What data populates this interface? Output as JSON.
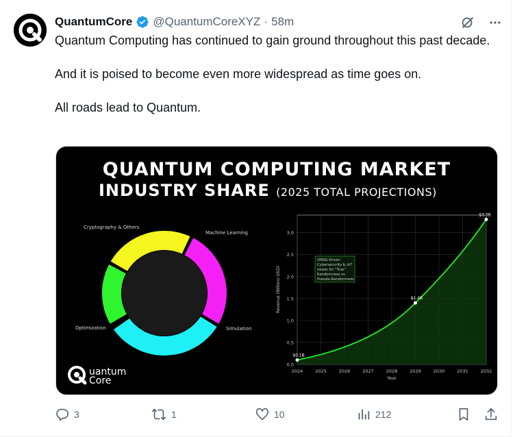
{
  "tweet": {
    "name": "QuantumCore",
    "handle": "@QuantumCoreXYZ",
    "separator": "·",
    "time": "58m",
    "text_lines": [
      "Quantum Computing has continued to gain ground throughout this past decade.",
      "And it is poised to become even more widespread as time goes on.",
      "All roads lead to Quantum."
    ]
  },
  "media": {
    "title_line1": "QUANTUM COMPUTING MARKET",
    "title_line2": "INDUSTRY SHARE",
    "title_line2_small": "(2025 TOTAL PROJECTIONS)",
    "logo_line1": "uantum",
    "logo_line2": "Core",
    "donut_labels": {
      "crypto": "Cryptography & Others",
      "ml": "Machine Learning",
      "sim": "Simulation",
      "opt": "Optimization"
    },
    "donut_colors": {
      "crypto": "#2ef52e",
      "ml": "#f5f520",
      "sim": "#f520f5",
      "opt": "#1ff0f5"
    },
    "annotation": [
      "QRNG Driver:",
      "Cybersecurity & IoT",
      "needs for \"True\"",
      "Randomness vs.",
      "Pseudo-Randomness"
    ]
  },
  "chart_data": {
    "type": "line",
    "x": [
      2024,
      2029,
      2032
    ],
    "y": [
      0.1,
      1.4,
      3.3
    ],
    "point_labels": [
      "$0.1B",
      "$1.4B",
      "$3.3B"
    ],
    "xlabel": "Year",
    "ylabel": "Revenue (Billions USD)",
    "xticks": [
      "2024",
      "2025",
      "2026",
      "2027",
      "2028",
      "2029",
      "2030",
      "2031",
      "2032"
    ],
    "yticks": [
      "0.0",
      "0.5",
      "1.0",
      "1.5",
      "2.0",
      "2.5",
      "3.0"
    ],
    "xlim": [
      2024,
      2032
    ],
    "ylim": [
      0,
      3.4
    ],
    "grid": true,
    "line_color": "#22ee22"
  },
  "actions": {
    "reply_count": "3",
    "retweet_count": "1",
    "like_count": "10",
    "view_count": "212"
  },
  "colors": {
    "verified": "#1d9bf0",
    "muted": "#536471"
  }
}
